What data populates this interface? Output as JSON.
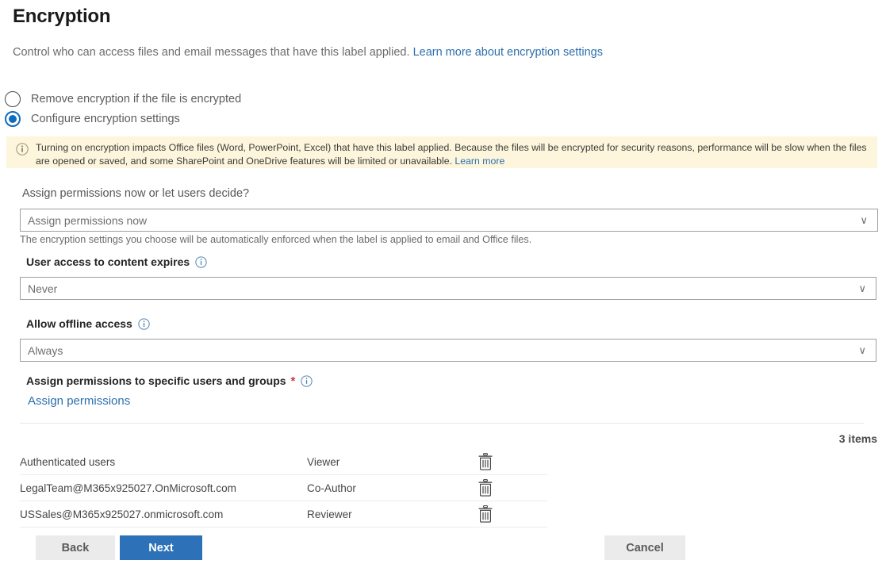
{
  "header": {
    "title": "Encryption",
    "subtitle_text": "Control who can access files and email messages that have this label applied.",
    "subtitle_link": "Learn more about encryption settings"
  },
  "radios": {
    "option1_label": "Remove encryption if the file is encrypted",
    "option2_label": "Configure encryption settings",
    "selected": "option2"
  },
  "banner": {
    "icon": "info-icon",
    "text": "Turning on encryption impacts Office files (Word, PowerPoint, Excel) that have this label applied. Because the files will be encrypted for security reasons, performance will be slow when the files are opened or saved, and some SharePoint and OneDrive features will be limited or unavailable.",
    "link": "Learn more"
  },
  "form": {
    "assign_question_label": "Assign permissions now or let users decide?",
    "assign_question_value": "Assign permissions now",
    "assign_helper": "The encryption settings you choose will be automatically enforced when the label is applied to email and Office files.",
    "expires_label": "User access to content expires",
    "expires_value": "Never",
    "offline_label": "Allow offline access",
    "offline_value": "Always",
    "specific_label": "Assign permissions to specific users and groups",
    "required_marker": "*",
    "assign_permissions_link": "Assign permissions",
    "caret_glyph": "∨"
  },
  "table": {
    "items_count": "3 items",
    "rows": [
      {
        "user": "Authenticated users",
        "role": "Viewer",
        "delete_icon": "trash-icon"
      },
      {
        "user": "LegalTeam@M365x925027.OnMicrosoft.com",
        "role": "Co-Author",
        "delete_icon": "trash-icon"
      },
      {
        "user": "USSales@M365x925027.onmicrosoft.com",
        "role": "Reviewer",
        "delete_icon": "trash-icon"
      }
    ]
  },
  "footer": {
    "back_label": "Back",
    "next_label": "Next",
    "cancel_label": "Cancel"
  },
  "colors": {
    "accent": "#2d72b8",
    "link": "#2c6fad",
    "banner_bg": "#fdf6dd",
    "required": "#d13438"
  }
}
